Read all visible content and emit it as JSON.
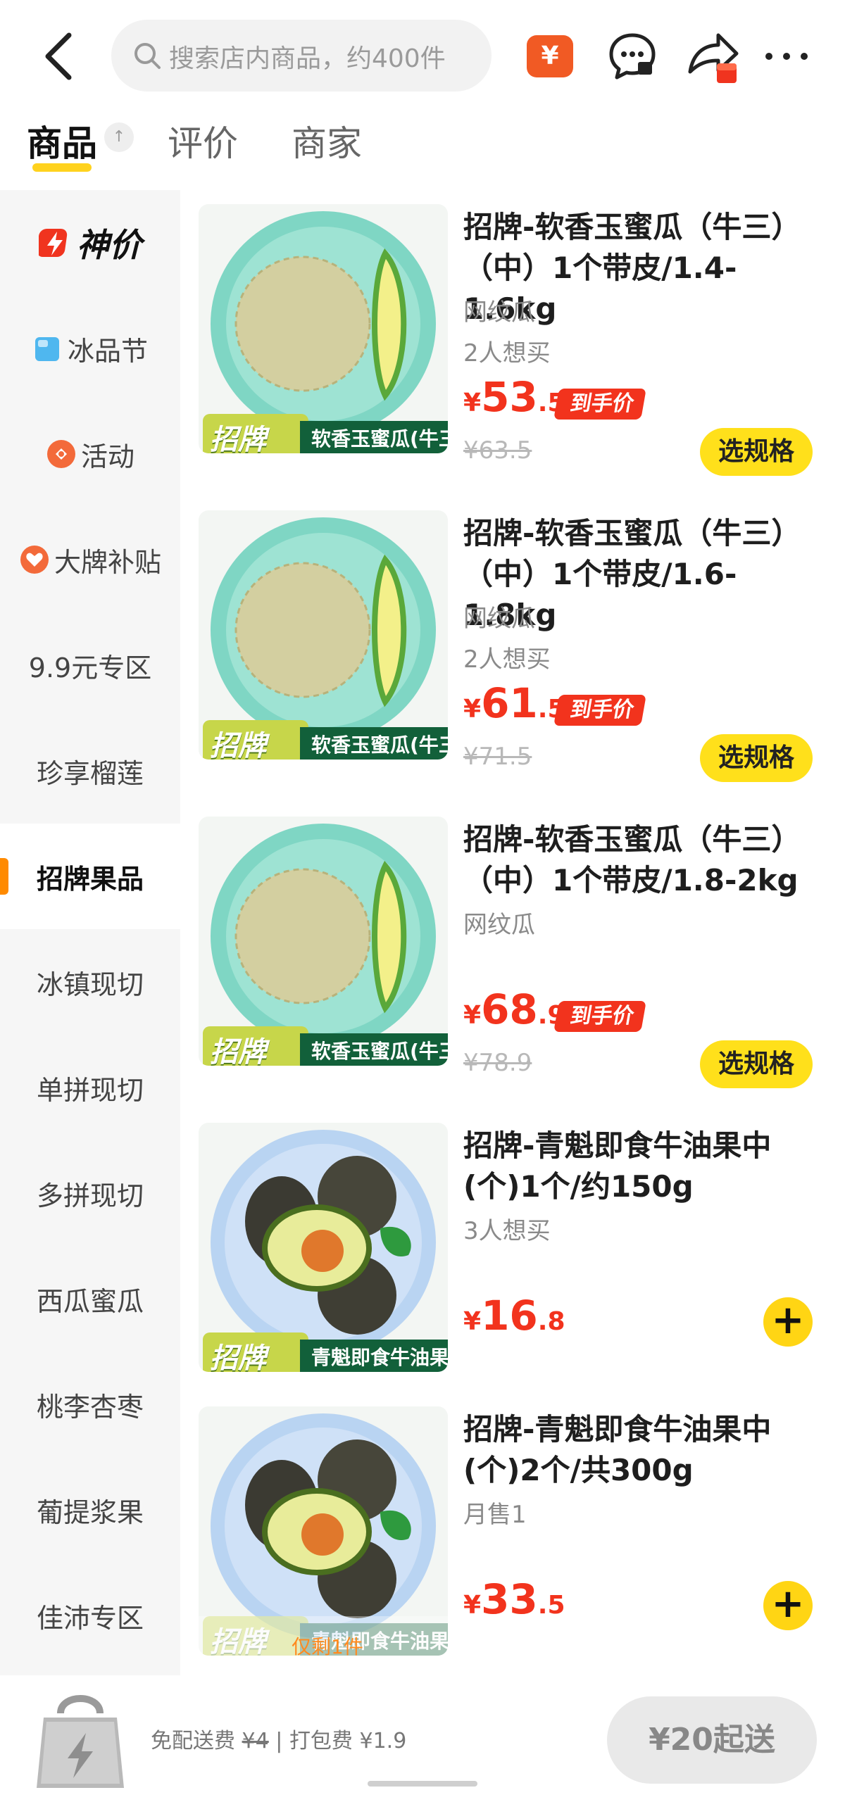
{
  "header": {
    "search_placeholder": "搜索店内商品，约400件",
    "coupon_symbol": "¥"
  },
  "tabs": [
    {
      "label": "商品",
      "active": true
    },
    {
      "label": "评价",
      "active": false
    },
    {
      "label": "商家",
      "active": false
    }
  ],
  "tab_sort_glyph": "↑",
  "sidebar": {
    "items": [
      {
        "label": "神价",
        "icon": "lightning-badge-icon"
      },
      {
        "label": "冰品节",
        "icon": "ice-cube-icon"
      },
      {
        "label": "活动",
        "icon": "activity-badge-icon"
      },
      {
        "label": "大牌补贴",
        "icon": "heart-badge-icon"
      },
      {
        "label": "9.9元专区"
      },
      {
        "label": "珍享榴莲"
      },
      {
        "label": "招牌果品",
        "active": true
      },
      {
        "label": "冰镇现切"
      },
      {
        "label": "单拼现切"
      },
      {
        "label": "多拼现切"
      },
      {
        "label": "西瓜蜜瓜"
      },
      {
        "label": "桃李杏枣"
      },
      {
        "label": "葡提浆果"
      },
      {
        "label": "佳沛专区"
      }
    ]
  },
  "products": [
    {
      "title": "招牌-软香玉蜜瓜（牛三）（中）1个带皮/1.4-1.6kg",
      "subtitle": "网纹瓜",
      "wants": "2人想买",
      "price_symbol": "¥",
      "price_int": "53",
      "price_dec": ".5",
      "tag": "到手价",
      "original_price": "¥63.5",
      "action": "选规格",
      "image_brand": "招牌",
      "image_label": "软香玉蜜瓜(牛三)"
    },
    {
      "title": "招牌-软香玉蜜瓜（牛三）（中）1个带皮/1.6-1.8kg",
      "subtitle": "网纹瓜",
      "wants": "2人想买",
      "price_symbol": "¥",
      "price_int": "61",
      "price_dec": ".5",
      "tag": "到手价",
      "original_price": "¥71.5",
      "action": "选规格",
      "image_brand": "招牌",
      "image_label": "软香玉蜜瓜(牛三)"
    },
    {
      "title": "招牌-软香玉蜜瓜（牛三）（中）1个带皮/1.8-2kg",
      "subtitle": "网纹瓜",
      "price_symbol": "¥",
      "price_int": "68",
      "price_dec": ".9",
      "tag": "到手价",
      "original_price": "¥78.9",
      "action": "选规格",
      "image_brand": "招牌",
      "image_label": "软香玉蜜瓜(牛三)"
    },
    {
      "title": "招牌-青魁即食牛油果中(个)1个/约150g",
      "wants": "3人想买",
      "price_symbol": "¥",
      "price_int": "16",
      "price_dec": ".8",
      "action": "+",
      "image_brand": "招牌",
      "image_label": "青魁即食牛油果"
    },
    {
      "title": "招牌-青魁即食牛油果中(个)2个/共300g",
      "subtitle": "月售1",
      "price_symbol": "¥",
      "price_int": "33",
      "price_dec": ".5",
      "action": "+",
      "image_brand": "招牌",
      "image_label": "青魁即食牛油果",
      "stock_note": "仅剩1件"
    }
  ],
  "bottom": {
    "free_delivery_label": "免配送费",
    "delivery_fee_original": "¥4",
    "separator": "|",
    "packaging_label": "打包费",
    "packaging_fee": "¥1.9",
    "min_order": "¥20起送"
  },
  "colors": {
    "accent_yellow": "#ffe01b",
    "price_red": "#f2331d",
    "active_marker": "#ff8a00"
  }
}
